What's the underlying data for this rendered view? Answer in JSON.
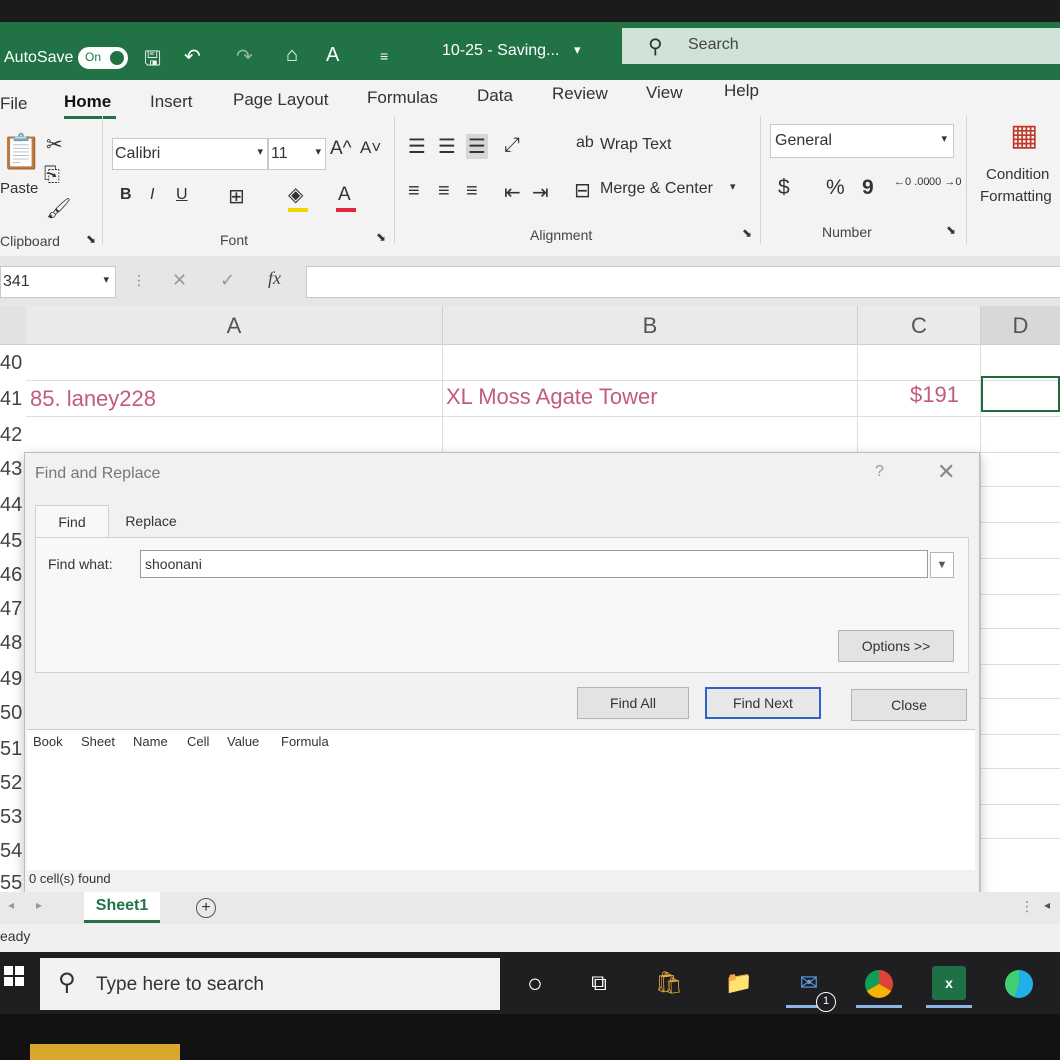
{
  "titlebar": {
    "autosave_label": "AutoSave",
    "autosave_state": "On",
    "document_title": "10-25  -  Saving...",
    "title_dropdown": "▾",
    "search_placeholder": "Search"
  },
  "ribbon": {
    "tabs": [
      "File",
      "Home",
      "Insert",
      "Page Layout",
      "Formulas",
      "Data",
      "Review",
      "View",
      "Help"
    ],
    "clipboard": {
      "paste": "Paste",
      "group": "Clipboard"
    },
    "font": {
      "name": "Calibri",
      "size": "11",
      "bold": "B",
      "italic": "I",
      "underline": "U",
      "grow": "A^",
      "shrink": "A˅",
      "color_letter": "A",
      "group": "Font"
    },
    "alignment": {
      "wrap_text": "Wrap Text",
      "merge_center": "Merge & Center",
      "group": "Alignment"
    },
    "number": {
      "format": "General",
      "currency": "$",
      "percent": "%",
      "comma": "9",
      "inc_dec": "←0 .00",
      "dec_dec": ".00 →0",
      "group": "Number"
    },
    "conditional": {
      "line1": "Condition",
      "line2": "Formatting"
    }
  },
  "formula_bar": {
    "name_box": "341",
    "cancel": "✕",
    "enter": "✓",
    "fx": "fx",
    "value": ""
  },
  "grid": {
    "columns": [
      "A",
      "B",
      "C",
      "D"
    ],
    "rows": [
      "40",
      "41",
      "42",
      "43",
      "44",
      "45",
      "46",
      "47",
      "48",
      "49",
      "50",
      "51",
      "52",
      "53",
      "54",
      "55"
    ],
    "cells": {
      "a41": "85. laney228",
      "b41": "XL Moss Agate Tower",
      "c41": "$191"
    }
  },
  "find_replace": {
    "title": "Find and Replace",
    "help": "?",
    "close_x": "✕",
    "tabs": {
      "find": "Find",
      "replace": "Replace"
    },
    "find_what_label": "Find what:",
    "find_what_value": "shoonani",
    "options_button": "Options >>",
    "find_all_button": "Find All",
    "find_next_button": "Find Next",
    "close_button": "Close",
    "result_columns": [
      "Book",
      "Sheet",
      "Name",
      "Cell",
      "Value",
      "Formula"
    ],
    "status": "0 cell(s) found"
  },
  "sheets": {
    "active": "Sheet1",
    "add": "+"
  },
  "statusbar": {
    "text": "eady"
  },
  "taskbar": {
    "search_placeholder": "Type here to search",
    "mail_badge": "1"
  },
  "colors": {
    "excel_green": "#217346",
    "cell_text": "#c25b7c",
    "focus_blue": "#2b66c4"
  }
}
